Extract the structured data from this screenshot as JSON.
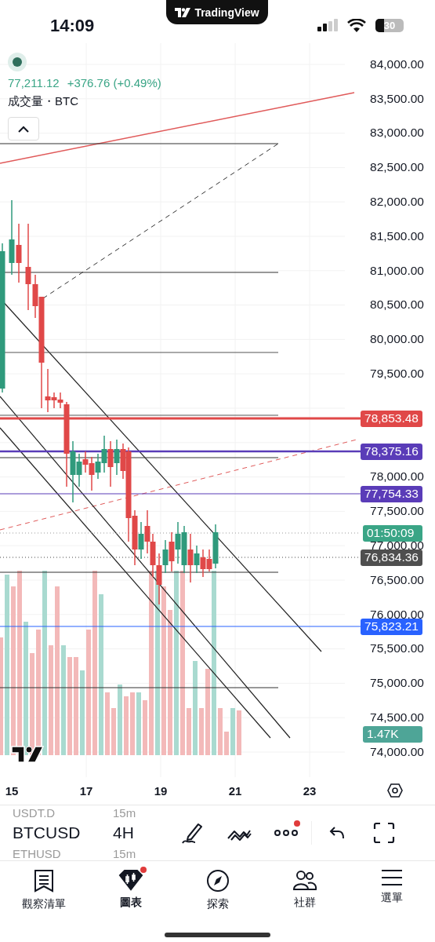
{
  "status_bar": {
    "time": "14:09",
    "app_pill": "TradingView",
    "battery": "30"
  },
  "legend": {
    "price": "77,211.12",
    "change": "+376.76 (+0.49%)",
    "volume_label": "成交量・BTC"
  },
  "price_axis": [
    "84,000.00",
    "83,500.00",
    "83,000.00",
    "82,500.00",
    "82,000.00",
    "81,500.00",
    "81,000.00",
    "80,500.00",
    "80,000.00",
    "79,500.00",
    "78,000.00",
    "77,500.00",
    "77,000.00",
    "76,500.00",
    "76,000.00",
    "75,500.00",
    "75,000.00",
    "74,500.00",
    "74,000.00"
  ],
  "price_tags": [
    {
      "text": "78,853.48",
      "color": "#e04848"
    },
    {
      "text": "78,375.16",
      "color": "#5a3cb8"
    },
    {
      "text": "77,754.33",
      "color": "#5a3cb8"
    },
    {
      "text": "01:50:09",
      "color": "#3aa586"
    },
    {
      "text": "76,834.36",
      "color": "#4f4f4f"
    },
    {
      "text": "75,823.21",
      "color": "#2962ff"
    },
    {
      "text": "1.47K",
      "color": "#4ea597"
    }
  ],
  "time_axis": [
    "15",
    "17",
    "19",
    "21",
    "23"
  ],
  "symbols": [
    {
      "symbol": "USDT.D",
      "interval": "15m",
      "selected": false
    },
    {
      "symbol": "BTCUSD",
      "interval": "4H",
      "selected": true
    },
    {
      "symbol": "ETHUSD",
      "interval": "15m",
      "selected": false
    }
  ],
  "tools": [
    {
      "kind": "draw",
      "dot": false
    },
    {
      "kind": "patterns",
      "dot": false
    },
    {
      "kind": "more",
      "dot": true
    },
    {
      "kind": "undo",
      "dot": false
    },
    {
      "kind": "fullscreen",
      "dot": false
    }
  ],
  "nav": [
    {
      "label": "觀察清單",
      "kind": "watchlist",
      "selected": false,
      "dot": false
    },
    {
      "label": "圖表",
      "kind": "chart",
      "selected": true,
      "dot": true
    },
    {
      "label": "探索",
      "kind": "explore",
      "selected": false,
      "dot": false
    },
    {
      "label": "社群",
      "kind": "community",
      "selected": false,
      "dot": false
    },
    {
      "label": "選單",
      "kind": "menu",
      "selected": false,
      "dot": false
    }
  ]
}
